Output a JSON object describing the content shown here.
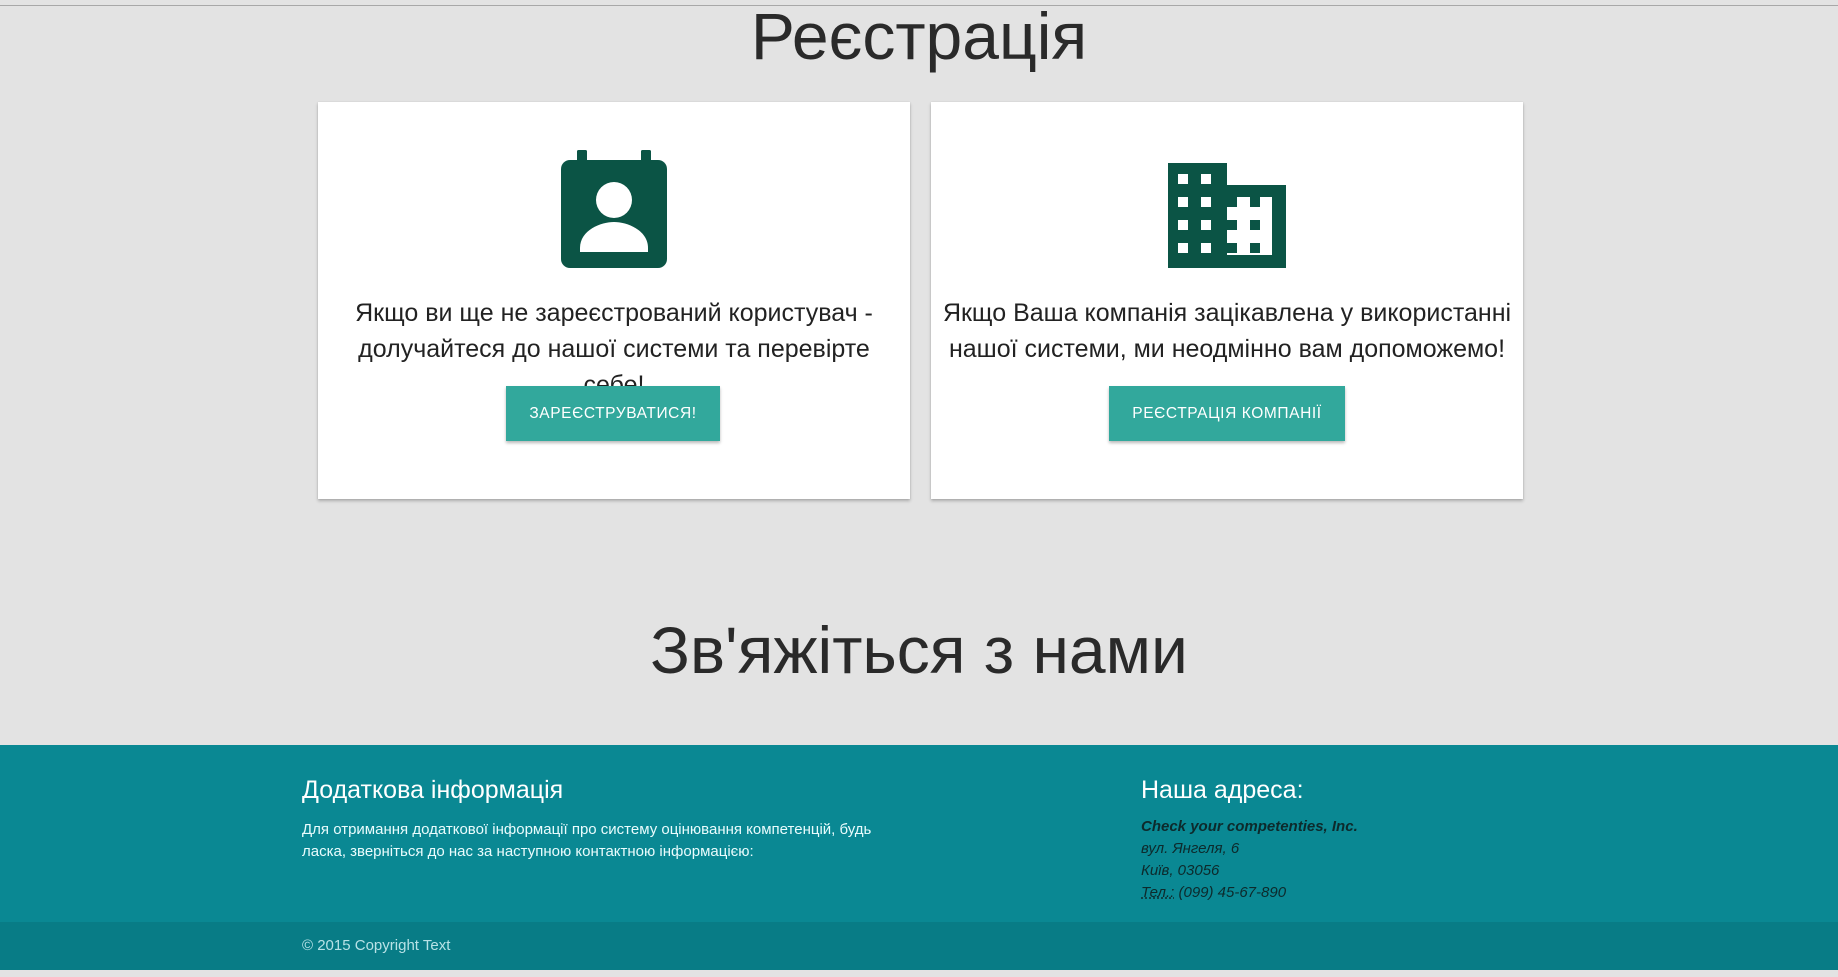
{
  "registration": {
    "title": "Реєстрація",
    "user_card": {
      "icon": "contact-calendar-icon",
      "text": "Якщо ви ще не зареєстрований користувач - долучайтеся до нашої системи та перевірте себе!",
      "button_label": "Зареєструватися!"
    },
    "company_card": {
      "icon": "business-building-icon",
      "text": "Якщо Ваша компанія зацікавлена у використанні нашої системи, ми неодмінно вам допоможемо!",
      "button_label": "Реєстрація компанії"
    }
  },
  "contact": {
    "title": "Зв'яжіться з нами"
  },
  "footer": {
    "info_title": "Додаткова інформація",
    "info_text": "Для отримання додаткової інформації про систему оцінювання компетенцій, будь ласка, зверніться до нас за наступною контактною інформацією:",
    "address_title": "Наша адреса:",
    "address": {
      "company": "Check your competenties, Inc.",
      "street": "вул. Янгеля, 6",
      "city": "Київ, 03056",
      "tel_label": "Тел.:",
      "tel_value": " (099) 45-67-890"
    },
    "copyright": "© 2015 Copyright Text"
  },
  "colors": {
    "icon": "#0b5445",
    "button": "#32a89c",
    "footer": "#0a8893",
    "footer_bottom": "#087c86",
    "page_bg": "#e3e3e3"
  }
}
